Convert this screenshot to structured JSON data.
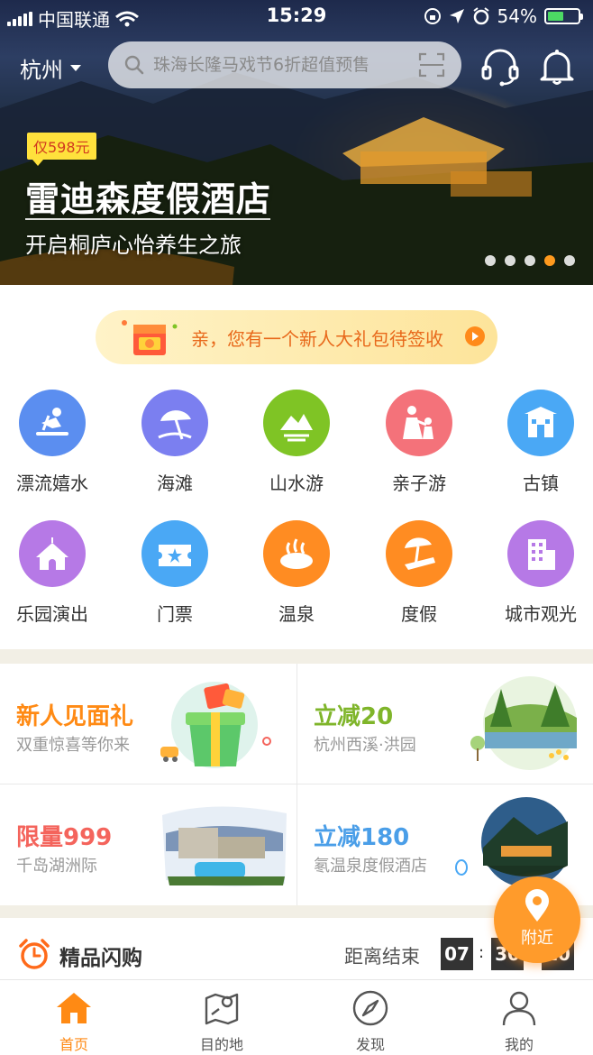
{
  "status_bar": {
    "carrier": "中国联通",
    "time": "15:29",
    "battery": "54%"
  },
  "header": {
    "city": "杭州",
    "search_placeholder": "珠海长隆马戏节6折超值预售"
  },
  "hero": {
    "price_tag": "仅598元",
    "title": "雷迪森度假酒店",
    "subtitle": "开启桐庐心怡养生之旅",
    "slide_count": 5,
    "active_slide": 4
  },
  "gift_banner": {
    "text": "亲，您有一个新人大礼包待签收"
  },
  "categories": [
    {
      "label": "漂流嬉水",
      "icon": "rafting-icon",
      "color": "#5b8ef0"
    },
    {
      "label": "海滩",
      "icon": "beach-icon",
      "color": "#7b7ff0"
    },
    {
      "label": "山水游",
      "icon": "mountain-icon",
      "color": "#7fc425"
    },
    {
      "label": "亲子游",
      "icon": "family-icon",
      "color": "#f4727a"
    },
    {
      "label": "古镇",
      "icon": "old-town-icon",
      "color": "#4aa8f5"
    },
    {
      "label": "乐园演出",
      "icon": "amusement-park-icon",
      "color": "#b679e6"
    },
    {
      "label": "门票",
      "icon": "ticket-icon",
      "color": "#4aa8f5"
    },
    {
      "label": "温泉",
      "icon": "hot-spring-icon",
      "color": "#ff8c22"
    },
    {
      "label": "度假",
      "icon": "vacation-icon",
      "color": "#ff8c22"
    },
    {
      "label": "城市观光",
      "icon": "city-tour-icon",
      "color": "#b679e6"
    }
  ],
  "promos": [
    {
      "title": "新人见面礼",
      "subtitle": "双重惊喜等你来",
      "color": "#ff8a14"
    },
    {
      "title": "立减20",
      "subtitle": "杭州西溪·洪园",
      "color": "#7fb52a"
    },
    {
      "title": "限量999",
      "subtitle": "千岛湖洲际",
      "color": "#f4645c"
    },
    {
      "title": "立减180",
      "subtitle": "氡温泉度假酒店",
      "color": "#4a9ee8"
    }
  ],
  "flash_sale": {
    "title": "精品闪购",
    "ends_label": "距离结束",
    "hours": "07",
    "minutes": "30",
    "seconds": "10"
  },
  "nearby_button": "附近",
  "tabs": [
    {
      "label": "首页",
      "icon": "home-icon",
      "active": true
    },
    {
      "label": "目的地",
      "icon": "map-icon",
      "active": false
    },
    {
      "label": "发现",
      "icon": "compass-icon",
      "active": false
    },
    {
      "label": "我的",
      "icon": "profile-icon",
      "active": false
    }
  ],
  "colors": {
    "accent": "#ff8a14",
    "separator": "#f2efe5"
  }
}
